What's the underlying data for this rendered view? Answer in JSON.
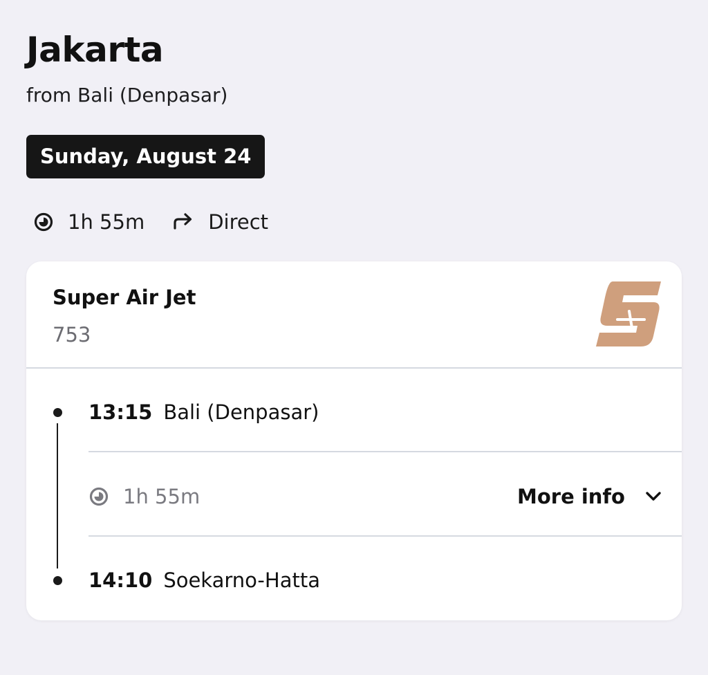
{
  "header": {
    "destination": "Jakarta",
    "origin_line": "from Bali (Denpasar)",
    "date": "Sunday, August 24"
  },
  "summary": {
    "duration": "1h 55m",
    "stops": "Direct",
    "duration_icon": "clock-icon",
    "stops_icon": "arrow-right-icon"
  },
  "flight": {
    "airline": "Super Air Jet",
    "number": "753",
    "logo_icon": "airline-logo",
    "logo_color": "#cf9f7d",
    "departure": {
      "time": "13:15",
      "place": "Bali (Denpasar)"
    },
    "leg_duration": "1h 55m",
    "more_info_label": "More info",
    "arrival": {
      "time": "14:10",
      "place": "Soekarno-Hatta"
    }
  }
}
